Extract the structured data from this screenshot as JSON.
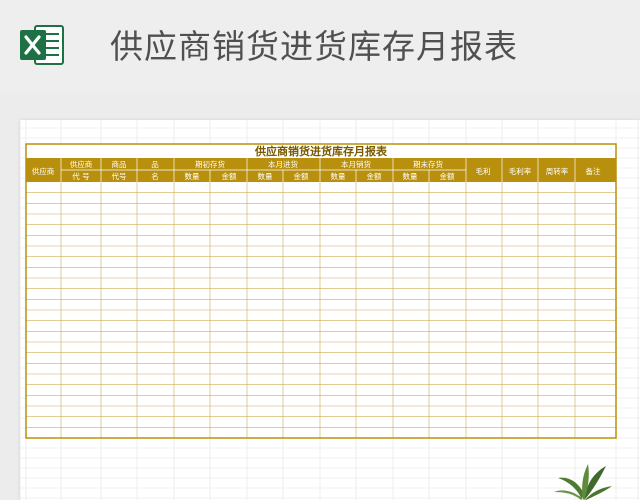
{
  "app": {
    "icon": "excel-icon",
    "title": "供应商销货进货库存月报表"
  },
  "sheet": {
    "title": "供应商销货进货库存月报表",
    "header_top": {
      "col1": "供应商",
      "col2": "供应商",
      "col3": "商品",
      "col4": "品",
      "group1": "期初存货",
      "group2": "本月进货",
      "group3": "本月销货",
      "group4": "期末存货",
      "col13": "毛利",
      "col14": "毛利率",
      "col15": "周转率",
      "col16": "备注"
    },
    "header_sub": {
      "col2": "代 号",
      "col3": "代号",
      "col4": "名",
      "qty": "数量",
      "amt": "金额"
    },
    "empty_rows": 24
  },
  "colors": {
    "accent_gold": "#b8900d",
    "title_text": "#7a5a00",
    "grid_line": "#c9ad55",
    "excel_green": "#1e7145"
  },
  "decor": {
    "plant": "plant-icon"
  }
}
